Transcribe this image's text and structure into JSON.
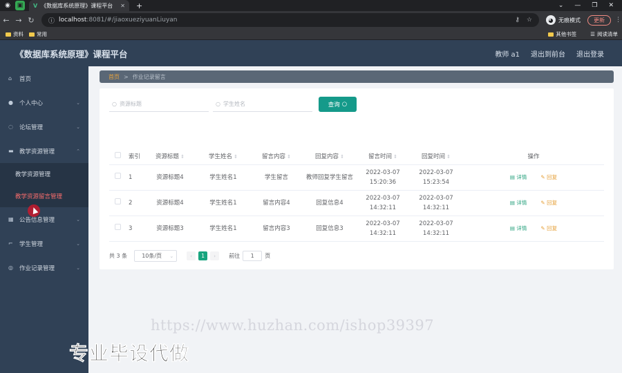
{
  "browser": {
    "tab_title": "《数据库系统原理》课程平台",
    "url_host": "localhost",
    "url_rest": ":8081/#/jiaoxueziyuanLiuyan",
    "profile_label": "无痕模式",
    "update_label": "更新",
    "bookmarks": [
      "资料",
      "常用"
    ],
    "bookmarks_right": [
      "其他书签",
      "阅读清单"
    ]
  },
  "header": {
    "title": "《数据库系统原理》课程平台",
    "user": "教师 a1",
    "back_front": "退出到前台",
    "logout": "退出登录"
  },
  "sidebar": {
    "items": [
      {
        "label": "首页",
        "icon": "home-icon"
      },
      {
        "label": "个人中心",
        "icon": "user-icon"
      },
      {
        "label": "论坛管理",
        "icon": "forum-icon"
      },
      {
        "label": "教学资源管理",
        "icon": "resource-icon"
      },
      {
        "label": "公告信息管理",
        "icon": "grid-icon"
      },
      {
        "label": "学生管理",
        "icon": "student-icon"
      },
      {
        "label": "作业记录管理",
        "icon": "homework-icon"
      }
    ],
    "sub_items": [
      "教学资源管理",
      "教学资源留言管理"
    ]
  },
  "breadcrumb": {
    "home": "首页",
    "sep": ">",
    "current": "作业记录留言"
  },
  "search": {
    "resource_placeholder": "资源标题",
    "student_placeholder": "学生姓名",
    "query_label": "查询"
  },
  "table": {
    "headers": [
      "索引",
      "资源标题",
      "学生姓名",
      "留言内容",
      "回复内容",
      "留言时间",
      "回复时间",
      "操作"
    ],
    "rows": [
      {
        "index": "1",
        "title": "资源标题4",
        "student": "学生姓名1",
        "message": "学生留言",
        "reply": "教师回复学生留言",
        "msg_time": "2022-03-07 15:20:36",
        "reply_time": "2022-03-07 15:23:54"
      },
      {
        "index": "2",
        "title": "资源标题4",
        "student": "学生姓名1",
        "message": "留言内容4",
        "reply": "回复信息4",
        "msg_time": "2022-03-07 14:32:11",
        "reply_time": "2022-03-07 14:32:11"
      },
      {
        "index": "3",
        "title": "资源标题3",
        "student": "学生姓名1",
        "message": "留言内容3",
        "reply": "回复信息3",
        "msg_time": "2022-03-07 14:32:11",
        "reply_time": "2022-03-07 14:32:11"
      }
    ],
    "detail_label": "详情",
    "reply_label": "回复"
  },
  "pager": {
    "total": "共 3 条",
    "page_size": "10条/页",
    "current_page": "1",
    "goto_prefix": "前往",
    "goto_value": "1",
    "goto_suffix": "页"
  },
  "overlay": {
    "watermark": "https://www.huzhan.com/ishop39397",
    "promo": "专业毕设代做"
  }
}
